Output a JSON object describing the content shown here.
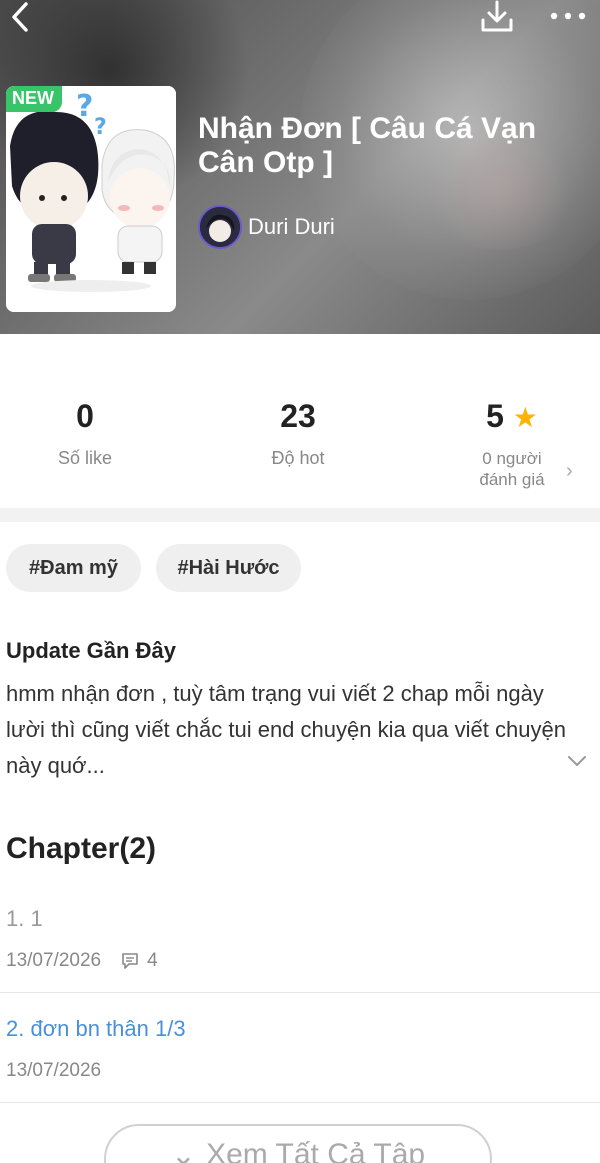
{
  "header": {
    "badge": "NEW",
    "title": "Nhận Đơn [ Câu Cá Vạn Cân Otp ]",
    "author": "Duri Duri",
    "icons": [
      "back-arrow-icon",
      "download-icon",
      "more-dots-icon"
    ]
  },
  "stats": [
    {
      "value": "0",
      "label": "Số like"
    },
    {
      "value": "23",
      "label": "Độ hot"
    },
    {
      "value": "5",
      "label_line1": "0 người",
      "label_line2": "đánh giá"
    }
  ],
  "tags": [
    "#Đam mỹ",
    "#Hài Hước"
  ],
  "update": {
    "title": "Update Gần Đây",
    "text": "hmm nhận đơn , tuỳ tâm trạng vui viết 2 chap mỗi ngày lười thì cũng viết chắc tui end chuyện kia qua viết chuyện này quớ..."
  },
  "chapters": {
    "heading": "Chapter(2)",
    "items": [
      {
        "title": "1. 1",
        "date": "13/07/2026",
        "comments": "4",
        "color": "#999999"
      },
      {
        "title": "2. đơn bn thân 1/3",
        "date": "13/07/2026",
        "color": "#4a90d9"
      }
    ],
    "view_all": "Xem Tất Cả Tập"
  },
  "colors": {
    "badge": "#39c46a",
    "star": "#ffb300",
    "link": "#4a90d9"
  }
}
